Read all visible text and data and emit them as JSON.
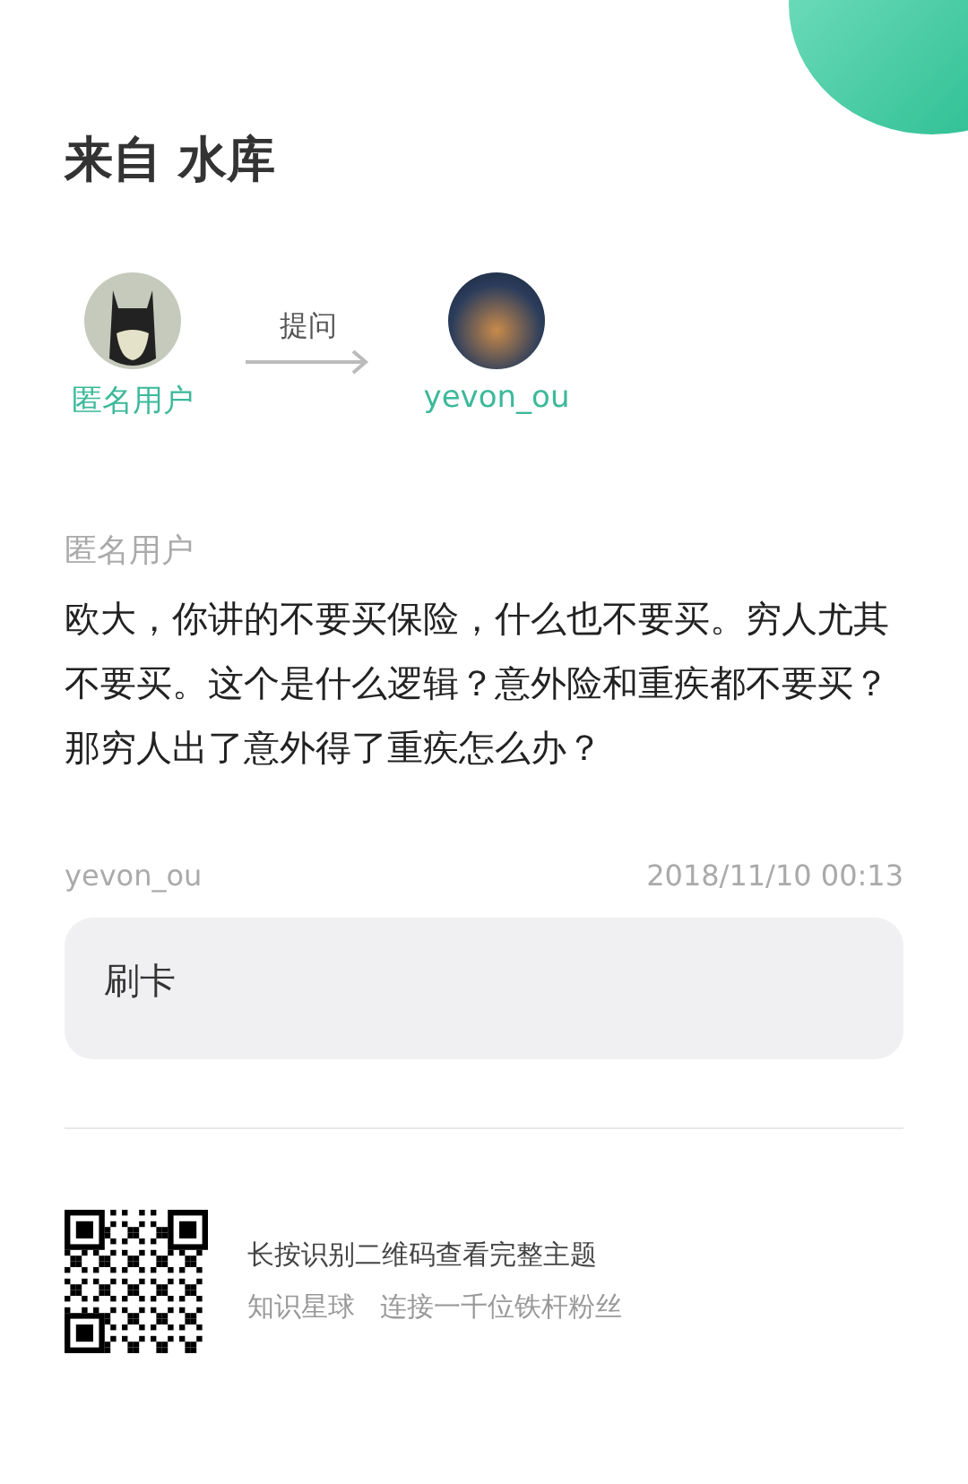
{
  "header": {
    "title": "来自 水库"
  },
  "flow": {
    "from": {
      "name": "匿名用户"
    },
    "action": "提问",
    "to": {
      "name": "yevon_ou"
    }
  },
  "question": {
    "author": "匿名用户",
    "text": "欧大，你讲的不要买保险，什么也不要买。穷人尤其不要买。这个是什么逻辑？意外险和重疾都不要买？那穷人出了意外得了重疾怎么办？"
  },
  "answer": {
    "author": "yevon_ou",
    "time": "2018/11/10 00:13",
    "text": "刷卡"
  },
  "footer": {
    "hint": "长按识别二维码查看完整主题",
    "brand": "知识星球",
    "slogan": "连接一千位铁杆粉丝"
  }
}
